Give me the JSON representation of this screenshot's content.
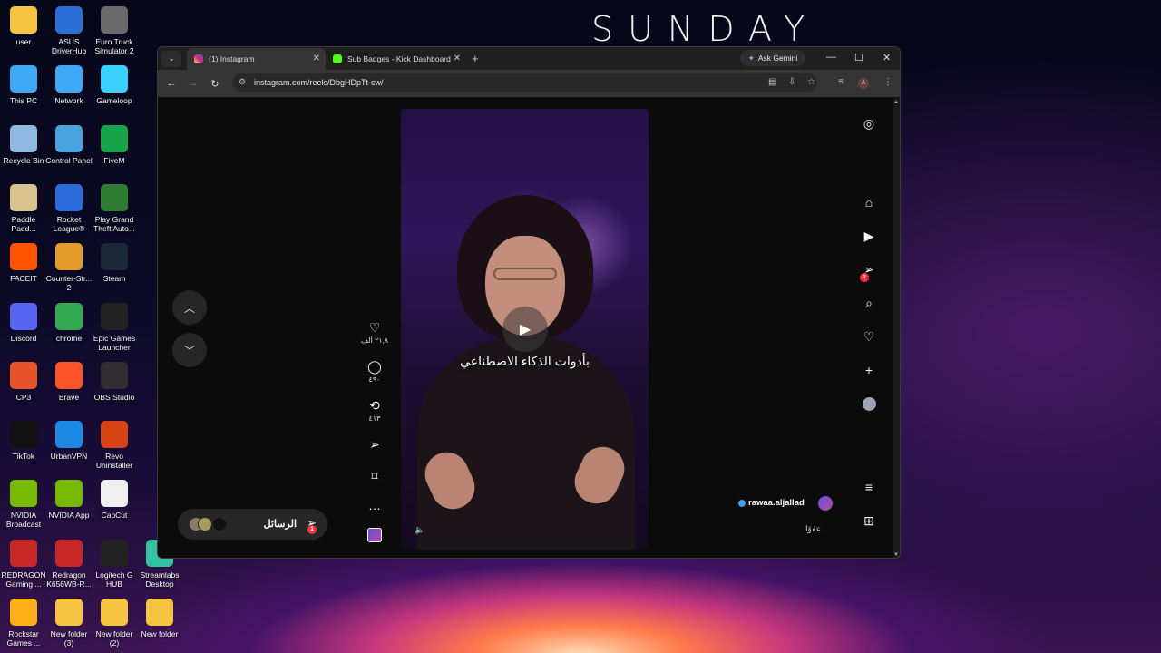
{
  "desktop": {
    "wallpaper_text": "SUNDAY",
    "icons": [
      {
        "label": "user",
        "icon": "folder-icon",
        "color": "#f5c542"
      },
      {
        "label": "ASUS DriverHub",
        "icon": "gear-icon",
        "color": "#2b6fd6"
      },
      {
        "label": "Euro Truck Simulator 2",
        "icon": "truck-icon",
        "color": "#6a6a6a"
      },
      {
        "label": "This PC",
        "icon": "monitor-icon",
        "color": "#3fa9f5"
      },
      {
        "label": "Network",
        "icon": "network-icon",
        "color": "#3fa9f5"
      },
      {
        "label": "Gameloop",
        "icon": "gameloop-icon",
        "color": "#3ad1ff"
      },
      {
        "label": "Recycle Bin",
        "icon": "recycle-bin-icon",
        "color": "#8fb8e0"
      },
      {
        "label": "Control Panel",
        "icon": "control-panel-icon",
        "color": "#4aa3df"
      },
      {
        "label": "FiveM",
        "icon": "fivem-icon",
        "color": "#1aa34a"
      },
      {
        "label": "Paddle Padd...",
        "icon": "paddle-icon",
        "color": "#d8c38c"
      },
      {
        "label": "Rocket League®",
        "icon": "rocket-league-icon",
        "color": "#2d6ad9"
      },
      {
        "label": "Play Grand Theft Auto...",
        "icon": "gta-icon",
        "color": "#2e7d32"
      },
      {
        "label": "FACEIT",
        "icon": "faceit-icon",
        "color": "#ff5500"
      },
      {
        "label": "Counter-Str... 2",
        "icon": "counter-strike-icon",
        "color": "#e59b2a"
      },
      {
        "label": "Steam",
        "icon": "steam-icon",
        "color": "#1b2838"
      },
      {
        "label": "Discord",
        "icon": "discord-icon",
        "color": "#5865f2"
      },
      {
        "label": "chrome",
        "icon": "chrome-icon",
        "color": "#34a853"
      },
      {
        "label": "Epic Games Launcher",
        "icon": "epic-games-icon",
        "color": "#222222"
      },
      {
        "label": "CP3",
        "icon": "cp3-icon",
        "color": "#e8542a"
      },
      {
        "label": "Brave",
        "icon": "brave-icon",
        "color": "#fb542b"
      },
      {
        "label": "OBS Studio",
        "icon": "obs-icon",
        "color": "#302e31"
      },
      {
        "label": "TikTok",
        "icon": "tiktok-icon",
        "color": "#111111"
      },
      {
        "label": "UrbanVPN",
        "icon": "urbanvpn-icon",
        "color": "#1e88e5"
      },
      {
        "label": "Revo Uninstaller",
        "icon": "revo-icon",
        "color": "#d84315"
      },
      {
        "label": "NVIDIA Broadcast",
        "icon": "nvidia-icon",
        "color": "#76b900"
      },
      {
        "label": "NVIDIA App",
        "icon": "nvidia-icon",
        "color": "#76b900"
      },
      {
        "label": "CapCut",
        "icon": "capcut-icon",
        "color": "#f0f0f0"
      },
      {
        "label": "REDRAGON Gaming ...",
        "icon": "redragon-icon",
        "color": "#c62828"
      },
      {
        "label": "Redragon K656WB-R...",
        "icon": "redragon-icon",
        "color": "#c62828"
      },
      {
        "label": "Logitech G HUB",
        "icon": "logitech-icon",
        "color": "#222222"
      },
      {
        "label": "Streamlabs Desktop",
        "icon": "streamlabs-icon",
        "color": "#31c3a2"
      },
      {
        "label": "Rockstar Games ...",
        "icon": "rockstar-icon",
        "color": "#fcaf17"
      },
      {
        "label": "New folder (3)",
        "icon": "folder-icon",
        "color": "#f5c542"
      },
      {
        "label": "New folder (2)",
        "icon": "folder-icon",
        "color": "#f5c542"
      },
      {
        "label": "New folder",
        "icon": "folder-icon",
        "color": "#f5c542"
      }
    ]
  },
  "browser": {
    "tabs": [
      {
        "label": "(1) Instagram",
        "favicon": "instagram-icon",
        "active": true
      },
      {
        "label": "Sub Badges - Kick Dashboard",
        "favicon": "kick-icon",
        "active": false
      }
    ],
    "ask_gemini": "Ask Gemini",
    "url": "instagram.com/reels/DbgHDpTt-cw/"
  },
  "reel": {
    "caption": "بأدوات الذكاء الاصطناعي",
    "likes": "٢١,٨ ألف",
    "comments": "٤٩٠",
    "reposts": "٤١٣",
    "author": "rawaa.aljallad",
    "sound": "عفوًا",
    "messages_label": "الرسائل",
    "messages_badge": "1",
    "notifications_badge": "1"
  },
  "colors": {
    "badge": "#ff3040",
    "verified": "#3ca0f0"
  }
}
